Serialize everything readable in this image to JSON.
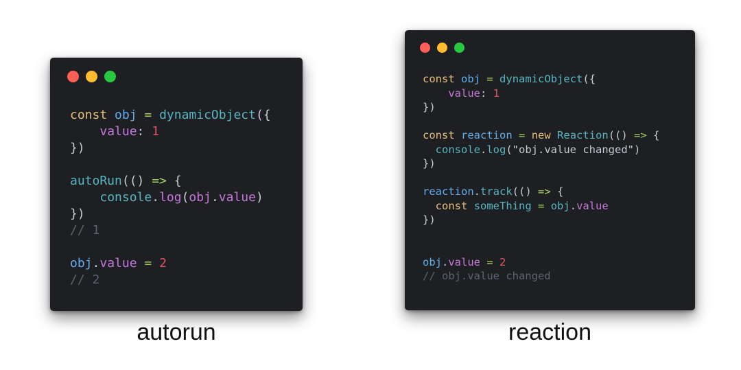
{
  "colors": {
    "window_bg": "#1e1f22",
    "dot_red": "#ff5f57",
    "dot_yellow": "#febc2e",
    "dot_green": "#28c840",
    "keyword": "#e5c07b",
    "function": "#56b6c2",
    "variable": "#61afef",
    "property": "#c678dd",
    "number": "#e05561",
    "operator": "#a8d060",
    "comment": "#5c6370",
    "plain": "#c8cbd2"
  },
  "panels": [
    {
      "caption": "autorun",
      "lines": [
        [
          [
            "kw",
            "const"
          ],
          [
            "p",
            " "
          ],
          [
            "var",
            "obj"
          ],
          [
            "p",
            " "
          ],
          [
            "op",
            "="
          ],
          [
            "p",
            " "
          ],
          [
            "fn",
            "dynamicObject"
          ],
          [
            "p",
            "({"
          ]
        ],
        [
          [
            "p",
            "    "
          ],
          [
            "prop",
            "value"
          ],
          [
            "p",
            ": "
          ],
          [
            "num",
            "1"
          ]
        ],
        [
          [
            "p",
            "})"
          ]
        ],
        [],
        [
          [
            "fn",
            "autoRun"
          ],
          [
            "p",
            "(() "
          ],
          [
            "op",
            "=>"
          ],
          [
            "p",
            " {"
          ]
        ],
        [
          [
            "p",
            "    "
          ],
          [
            "fn",
            "console"
          ],
          [
            "p",
            "."
          ],
          [
            "prop",
            "log"
          ],
          [
            "p",
            "("
          ],
          [
            "prop",
            "obj"
          ],
          [
            "p",
            "."
          ],
          [
            "prop",
            "value"
          ],
          [
            "p",
            ")"
          ]
        ],
        [
          [
            "p",
            "})"
          ]
        ],
        [
          [
            "c",
            "// 1"
          ]
        ],
        [],
        [
          [
            "var",
            "obj"
          ],
          [
            "p",
            "."
          ],
          [
            "prop",
            "value"
          ],
          [
            "p",
            " "
          ],
          [
            "op",
            "="
          ],
          [
            "p",
            " "
          ],
          [
            "num",
            "2"
          ]
        ],
        [
          [
            "c",
            "// 2"
          ]
        ]
      ]
    },
    {
      "caption": "reaction",
      "lines": [
        [
          [
            "kw",
            "const"
          ],
          [
            "p",
            " "
          ],
          [
            "var",
            "obj"
          ],
          [
            "p",
            " "
          ],
          [
            "op",
            "="
          ],
          [
            "p",
            " "
          ],
          [
            "fn",
            "dynamicObject"
          ],
          [
            "p",
            "({"
          ]
        ],
        [
          [
            "p",
            "    "
          ],
          [
            "prop",
            "value"
          ],
          [
            "p",
            ": "
          ],
          [
            "num",
            "1"
          ]
        ],
        [
          [
            "p",
            "})"
          ]
        ],
        [],
        [
          [
            "kw",
            "const"
          ],
          [
            "p",
            " "
          ],
          [
            "var",
            "reaction"
          ],
          [
            "p",
            " "
          ],
          [
            "op",
            "="
          ],
          [
            "p",
            " "
          ],
          [
            "kw",
            "new"
          ],
          [
            "p",
            " "
          ],
          [
            "fn",
            "Reaction"
          ],
          [
            "p",
            "(() "
          ],
          [
            "op",
            "=>"
          ],
          [
            "p",
            " {"
          ]
        ],
        [
          [
            "p",
            "  "
          ],
          [
            "fn",
            "console"
          ],
          [
            "p",
            "."
          ],
          [
            "fn",
            "log"
          ],
          [
            "p",
            "(\"obj.value changed\")"
          ]
        ],
        [
          [
            "p",
            "})"
          ]
        ],
        [],
        [
          [
            "var",
            "reaction"
          ],
          [
            "p",
            "."
          ],
          [
            "fn",
            "track"
          ],
          [
            "p",
            "(() "
          ],
          [
            "op",
            "=>"
          ],
          [
            "p",
            " {"
          ]
        ],
        [
          [
            "p",
            "  "
          ],
          [
            "kw",
            "const"
          ],
          [
            "p",
            " "
          ],
          [
            "fn",
            "someThing"
          ],
          [
            "p",
            " "
          ],
          [
            "op",
            "="
          ],
          [
            "p",
            " "
          ],
          [
            "fn",
            "obj"
          ],
          [
            "p",
            "."
          ],
          [
            "prop",
            "value"
          ]
        ],
        [
          [
            "p",
            "})"
          ]
        ],
        [],
        [],
        [
          [
            "var",
            "obj"
          ],
          [
            "p",
            "."
          ],
          [
            "prop",
            "value"
          ],
          [
            "p",
            " "
          ],
          [
            "op",
            "="
          ],
          [
            "p",
            " "
          ],
          [
            "num",
            "2"
          ]
        ],
        [
          [
            "c",
            "// obj.value changed"
          ]
        ]
      ]
    }
  ]
}
